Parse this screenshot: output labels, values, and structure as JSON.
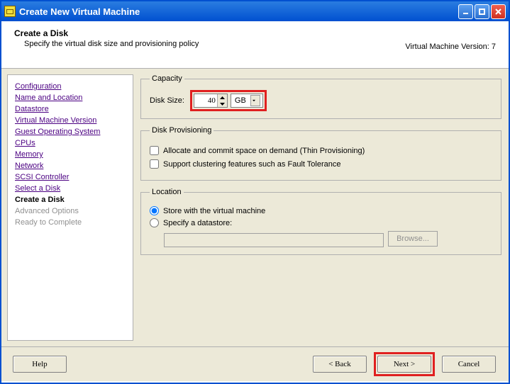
{
  "titlebar": {
    "title": "Create New Virtual Machine"
  },
  "header": {
    "title": "Create a Disk",
    "subtitle": "Specify the virtual disk size and provisioning policy",
    "version": "Virtual Machine Version: 7"
  },
  "sidebar": {
    "items": [
      {
        "label": "Configuration",
        "state": "link"
      },
      {
        "label": "Name and Location",
        "state": "link"
      },
      {
        "label": "Datastore",
        "state": "link"
      },
      {
        "label": "Virtual Machine Version",
        "state": "link"
      },
      {
        "label": "Guest Operating System",
        "state": "link"
      },
      {
        "label": "CPUs",
        "state": "link"
      },
      {
        "label": "Memory",
        "state": "link"
      },
      {
        "label": "Network",
        "state": "link"
      },
      {
        "label": "SCSI Controller",
        "state": "link"
      },
      {
        "label": "Select a Disk",
        "state": "link"
      },
      {
        "label": "Create a Disk",
        "state": "current"
      },
      {
        "label": "Advanced Options",
        "state": "disabled"
      },
      {
        "label": "Ready to Complete",
        "state": "disabled"
      }
    ]
  },
  "capacity": {
    "legend": "Capacity",
    "label": "Disk Size:",
    "value": "40",
    "unit": "GB"
  },
  "provisioning": {
    "legend": "Disk Provisioning",
    "thin_label": "Allocate and commit space on demand (Thin Provisioning)",
    "ft_label": "Support clustering features such as Fault Tolerance"
  },
  "location": {
    "legend": "Location",
    "opt_vm": "Store with the virtual machine",
    "opt_ds": "Specify a datastore:",
    "browse": "Browse..."
  },
  "footer": {
    "help": "Help",
    "back": "< Back",
    "next": "Next >",
    "cancel": "Cancel"
  }
}
